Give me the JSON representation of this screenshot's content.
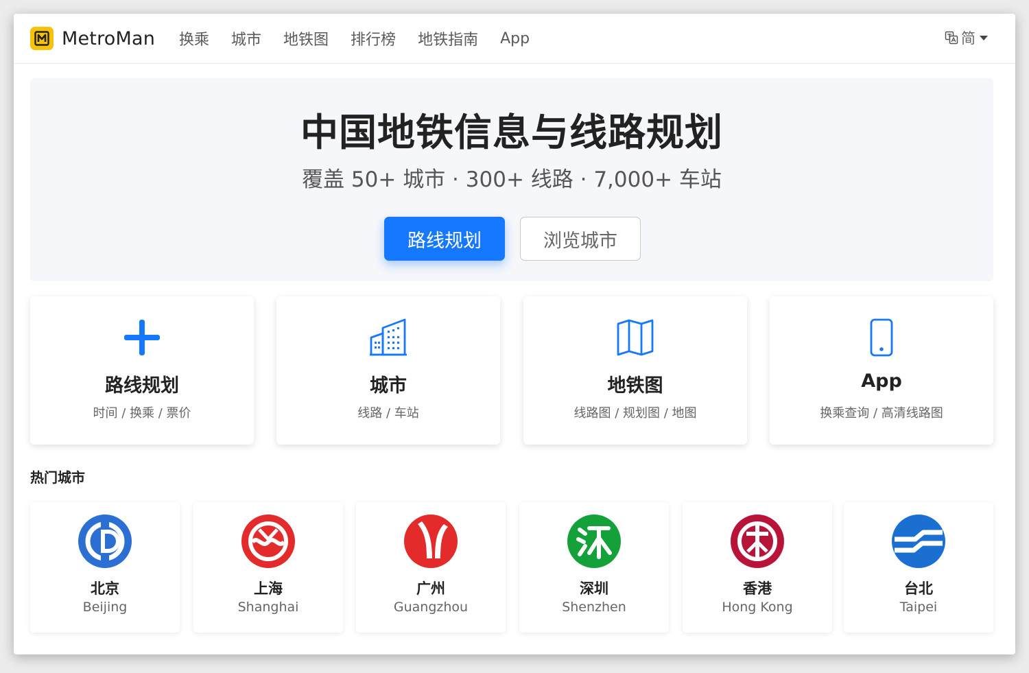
{
  "brand": {
    "name": "MetroMan",
    "logo_icon": "metroman-m-logo-icon",
    "logo_color": "#f6c20c"
  },
  "nav": {
    "links": [
      "换乘",
      "城市",
      "地铁图",
      "排行榜",
      "地铁指南",
      "App"
    ]
  },
  "language": {
    "label": "简",
    "icon": "translate-icon"
  },
  "hero": {
    "title": "中国地铁信息与线路规划",
    "subtitle": "覆盖 50+ 城市 · 300+ 线路 · 7,000+ 车站",
    "primary_button": "路线规划",
    "secondary_button": "浏览城市"
  },
  "features": [
    {
      "title": "路线规划",
      "desc": "时间 / 换乘 / 票价",
      "icon": "plus-icon"
    },
    {
      "title": "城市",
      "desc": "线路 / 车站",
      "icon": "buildings-icon"
    },
    {
      "title": "地铁图",
      "desc": "线路图 / 规划图 / 地图",
      "icon": "map-icon"
    },
    {
      "title": "App",
      "desc": "换乘查询 / 高清线路图",
      "icon": "phone-icon"
    }
  ],
  "hot_cities": {
    "title": "热门城市",
    "items": [
      {
        "cn": "北京",
        "en": "Beijing",
        "color": "#2b6fd3",
        "icon": "beijing-subway-logo-icon"
      },
      {
        "cn": "上海",
        "en": "Shanghai",
        "color": "#e32b2b",
        "icon": "shanghai-metro-logo-icon"
      },
      {
        "cn": "广州",
        "en": "Guangzhou",
        "color": "#e32b2b",
        "icon": "guangzhou-metro-logo-icon"
      },
      {
        "cn": "深圳",
        "en": "Shenzhen",
        "color": "#14a13a",
        "icon": "shenzhen-metro-logo-icon"
      },
      {
        "cn": "香港",
        "en": "Hong Kong",
        "color": "#b8143a",
        "icon": "mtr-logo-icon"
      },
      {
        "cn": "台北",
        "en": "Taipei",
        "color": "#1b6fd1",
        "icon": "taipei-metro-logo-icon"
      }
    ]
  },
  "colors": {
    "accent": "#1677ff"
  }
}
